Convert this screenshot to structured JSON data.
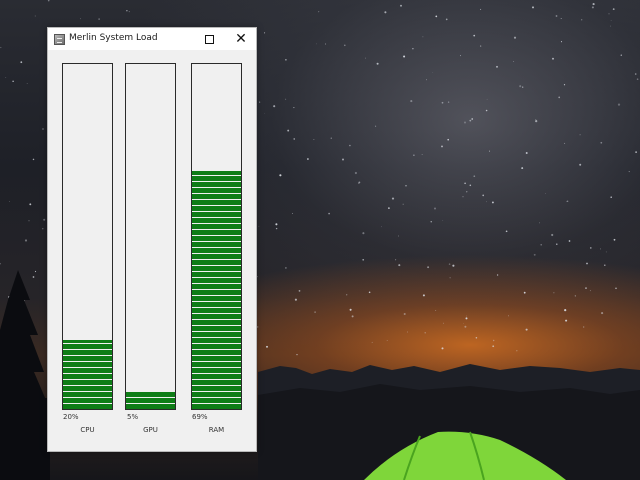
{
  "window": {
    "title": "Merlin System Load"
  },
  "gauges": [
    {
      "id": "cpu",
      "label": "CPU",
      "percent_text": "20%",
      "value": 0.2,
      "color": "#0e7d16"
    },
    {
      "id": "gpu",
      "label": "GPU",
      "percent_text": "5%",
      "value": 0.05,
      "color": "#0e7d16"
    },
    {
      "id": "ram",
      "label": "RAM",
      "percent_text": "69%",
      "value": 0.69,
      "color": "#0e7d16"
    }
  ],
  "icons": {
    "app": "app-icon",
    "maximize": "maximize-icon",
    "close": "close-icon"
  }
}
